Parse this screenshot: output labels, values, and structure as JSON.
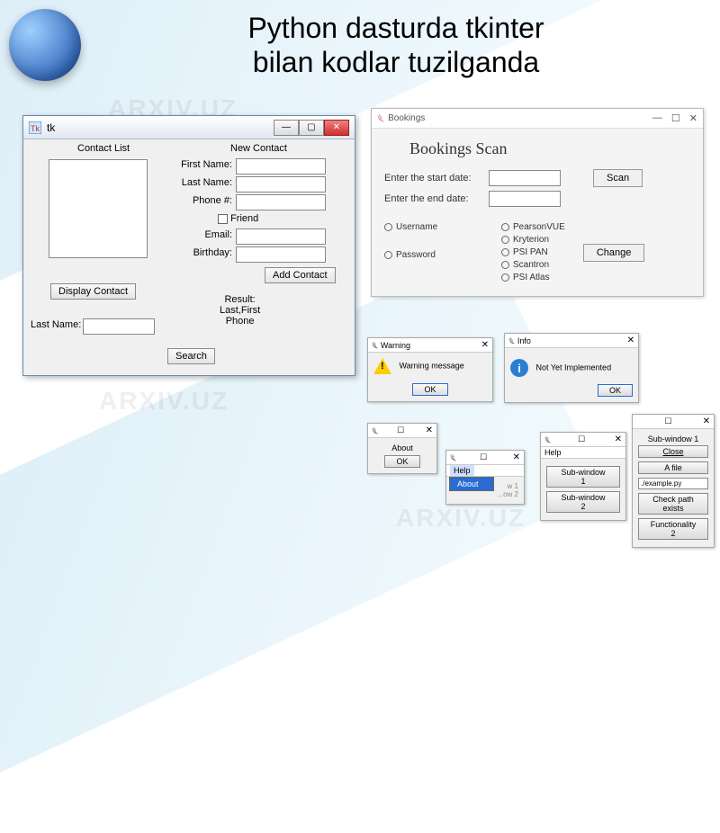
{
  "slide": {
    "title_line1": "Python dasturda tkinter",
    "title_line2": "bilan kodlar tuzilganda",
    "watermark": "ARXIV.UZ"
  },
  "tk_window": {
    "title": "tk",
    "contact_list_label": "Contact List",
    "new_contact_label": "New Contact",
    "first_name_label": "First Name:",
    "last_name_label": "Last Name:",
    "phone_label": "Phone #:",
    "friend_label": "Friend",
    "email_label": "Email:",
    "birthday_label": "Birthday:",
    "add_contact_btn": "Add Contact",
    "display_contact_btn": "Display Contact",
    "search_last_name_label": "Last Name:",
    "result_label": "Result:",
    "result_line1": "Last,First",
    "result_line2": "Phone",
    "search_btn": "Search"
  },
  "bookings": {
    "window_title": "Bookings",
    "heading": "Bookings Scan",
    "start_date_label": "Enter the start date:",
    "end_date_label": "Enter the end date:",
    "scan_btn": "Scan",
    "username_label": "Username",
    "password_label": "Password",
    "change_btn": "Change",
    "providers": [
      "PearsonVUE",
      "Kryterion",
      "PSI PAN",
      "Scantron",
      "PSI Atlas"
    ]
  },
  "dialogs": {
    "warning_title": "Warning",
    "warning_msg": "Warning message",
    "info_title": "Info",
    "info_msg": "Not Yet Implemented",
    "ok": "OK",
    "about_label": "About",
    "help_label": "Help",
    "menu_about": "About",
    "sub_window_1": "Sub-window 1",
    "sub_window_2": "Sub-window 2",
    "close_btn": "Close",
    "a_file_btn": "A file",
    "example_path": "./example.py",
    "check_path_btn": "Check path exists",
    "functionality_btn": "Functionality 2"
  }
}
